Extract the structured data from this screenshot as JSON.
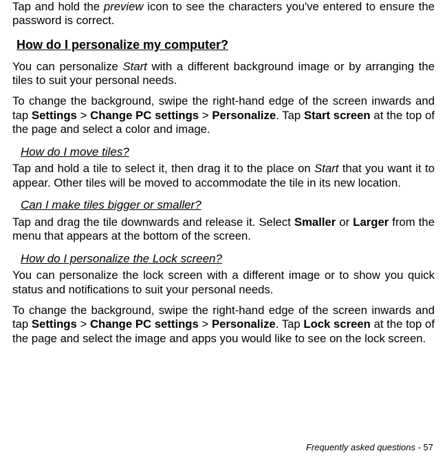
{
  "intro": {
    "p1_a": "Tap and hold the ",
    "p1_em": "preview",
    "p1_b": " icon to see the characters you've entered to ensure the password is correct."
  },
  "s1": {
    "heading": "How do I personalize my computer?",
    "p1_a": "You can personalize ",
    "p1_em": "Start",
    "p1_b": " with a different background image or by arranging the tiles to suit your personal needs.",
    "p2_a": "To change the background, swipe the right-hand edge of the screen inwards and tap ",
    "p2_b1": "Settings",
    "p2_c": " > ",
    "p2_b2": "Change PC settings",
    "p2_d": " > ",
    "p2_b3": "Personalize",
    "p2_e": ". Tap ",
    "p2_b4": "Start screen",
    "p2_f": " at the top of the page and select a color and image."
  },
  "s2": {
    "heading": "How do I move tiles?",
    "p1_a": "Tap and hold a tile to select it, then drag it to the place on ",
    "p1_em": "Start",
    "p1_b": " that you want it to appear. Other tiles will be moved to accommodate the tile in its new location."
  },
  "s3": {
    "heading": "Can I make tiles bigger or smaller?",
    "p1_a": "Tap and drag the tile downwards and release it. Select ",
    "p1_b1": "Smaller",
    "p1_b": " or ",
    "p1_b2": "Larger",
    "p1_c": " from the menu that appears at the bottom of the screen."
  },
  "s4": {
    "heading": "How do I personalize the Lock screen?",
    "p1": "You can personalize the lock screen with a different image or to show you quick status and notifications to suit your personal needs.",
    "p2_a": "To change the background, swipe the right-hand edge of the screen inwards and tap ",
    "p2_b1": "Settings",
    "p2_c": " > ",
    "p2_b2": "Change PC settings",
    "p2_d": " > ",
    "p2_b3": "Personalize",
    "p2_e": ". Tap ",
    "p2_b4": "Lock screen",
    "p2_f": " at the top of the page and select the image and apps you would like to see on the lock screen."
  },
  "footer": {
    "label": "Frequently asked questions -  ",
    "page": "57"
  }
}
